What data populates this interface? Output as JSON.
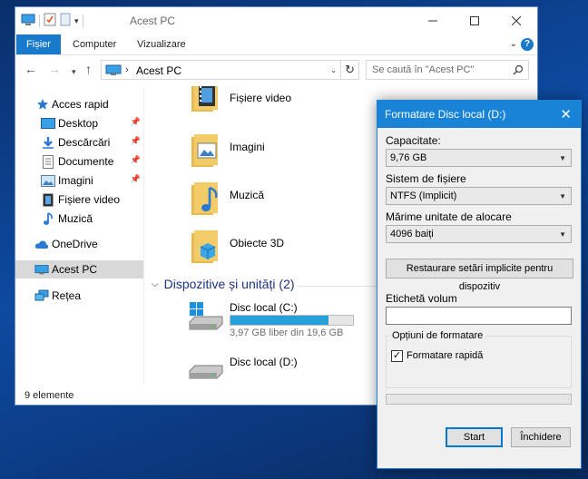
{
  "explorer": {
    "window_title": "Acest PC",
    "ribbon_tabs": [
      "Fișier",
      "Computer",
      "Vizualizare"
    ],
    "address_crumb": "Acest PC",
    "search_placeholder": "Se caută în \"Acest PC\"",
    "nav": {
      "quick_access": "Acces rapid",
      "items": [
        {
          "label": "Desktop",
          "icon": "desktop-icon",
          "pinned": true
        },
        {
          "label": "Descărcări",
          "icon": "download-icon",
          "pinned": true
        },
        {
          "label": "Documente",
          "icon": "documents-icon",
          "pinned": true
        },
        {
          "label": "Imagini",
          "icon": "pictures-icon",
          "pinned": true
        },
        {
          "label": "Fișiere video",
          "icon": "video-icon",
          "pinned": false
        },
        {
          "label": "Muzică",
          "icon": "music-icon",
          "pinned": false
        }
      ],
      "onedrive": "OneDrive",
      "this_pc": "Acest PC",
      "network": "Rețea"
    },
    "folders": [
      "Fișiere video",
      "Imagini",
      "Muzică",
      "Obiecte 3D"
    ],
    "devices_group": "Dispozitive și unități (2)",
    "drives": [
      {
        "name": "Disc local (C:)",
        "free_text": "3,97 GB liber din 19,6 GB",
        "used_fraction": 0.8
      },
      {
        "name": "Disc local (D:)"
      }
    ],
    "status": "9 elemente"
  },
  "dialog": {
    "title": "Formatare Disc local (D:)",
    "capacity_label": "Capacitate:",
    "capacity_value": "9,76 GB",
    "fs_label": "Sistem de fișiere",
    "fs_value": "NTFS (Implicit)",
    "alloc_label": "Mărime unitate de alocare",
    "alloc_value": "4096 baiți",
    "restore_button": "Restaurare setări implicite pentru dispozitiv",
    "volume_label": "Etichetă volum",
    "volume_value": "",
    "options_legend": "Opțiuni de formatare",
    "quick_format_label": "Formatare rapidă",
    "quick_format_checked": true,
    "progress": 0,
    "start_button": "Start",
    "close_button": "Închidere"
  },
  "colors": {
    "accent": "#1979ca",
    "dialog_title": "#1883d7",
    "drive_bar": "#26a0da",
    "desktop": "#0d4aa0"
  }
}
